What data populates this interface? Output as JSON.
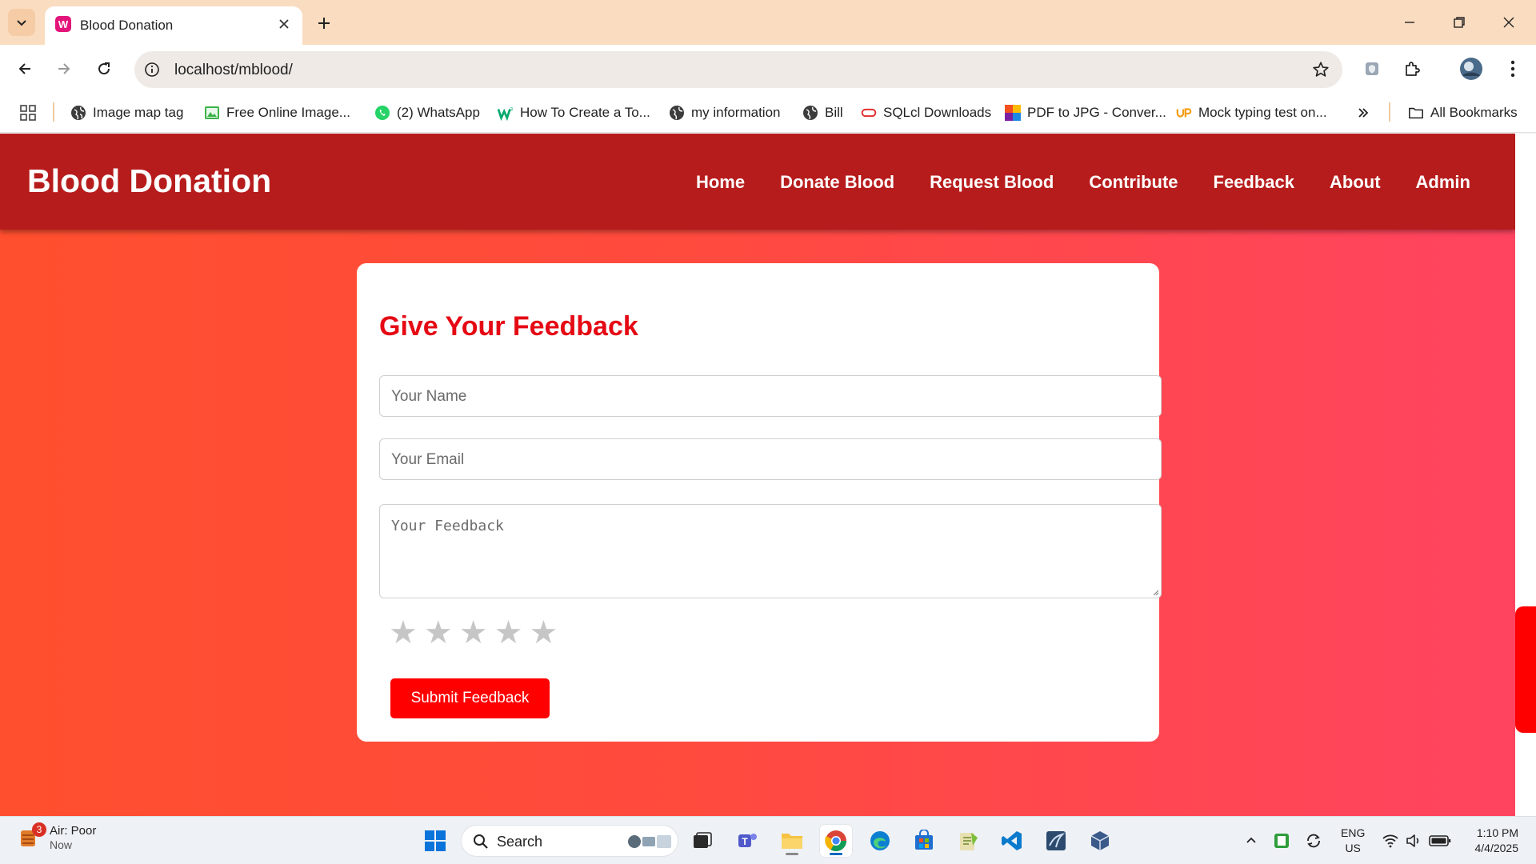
{
  "browser": {
    "tab_title": "Blood Donation",
    "url": "localhost/mblood/",
    "bookmarks": [
      {
        "label": "Image map tag",
        "icon": "globe-icon"
      },
      {
        "label": "Free Online Image...",
        "icon": "image-icon"
      },
      {
        "label": "(2) WhatsApp",
        "icon": "whatsapp-icon"
      },
      {
        "label": "How To Create a To...",
        "icon": "w3-icon"
      },
      {
        "label": "my information",
        "icon": "globe-icon"
      },
      {
        "label": "Bill",
        "icon": "globe-icon"
      },
      {
        "label": "SQLcl Downloads",
        "icon": "oracle-icon"
      },
      {
        "label": "PDF to JPG - Conver...",
        "icon": "pdf-jpg-icon"
      },
      {
        "label": "Mock typing test on...",
        "icon": "up-icon"
      }
    ],
    "all_bookmarks": "All Bookmarks"
  },
  "site": {
    "logo": "Blood Donation",
    "nav": [
      "Home",
      "Donate Blood",
      "Request Blood",
      "Contribute",
      "Feedback",
      "About",
      "Admin"
    ],
    "brand_color": "#b71c1c",
    "accent_color": "#e50914"
  },
  "feedback_form": {
    "title": "Give Your Feedback",
    "name_placeholder": "Your Name",
    "email_placeholder": "Your Email",
    "feedback_placeholder": "Your Feedback",
    "rating": {
      "value": 0,
      "max": 5
    },
    "submit_label": "Submit Feedback"
  },
  "taskbar": {
    "weather_title": "Air: Poor",
    "weather_sub": "Now",
    "weather_badge": "3",
    "search_label": "Search",
    "lang_top": "ENG",
    "lang_bottom": "US",
    "time": "1:10 PM",
    "date": "4/4/2025"
  }
}
